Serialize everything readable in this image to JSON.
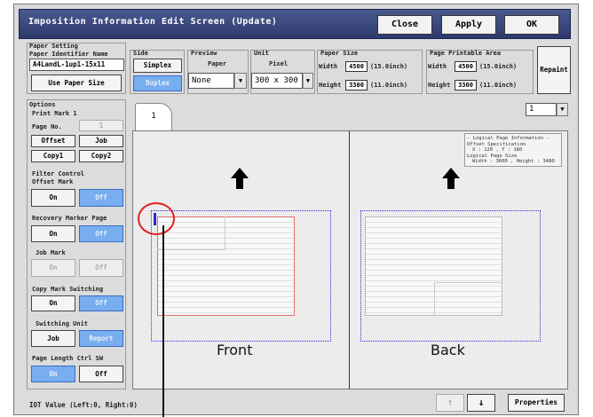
{
  "window": {
    "title": "Imposition Information Edit Screen (Update)"
  },
  "titlebar_buttons": {
    "close": "Close",
    "apply": "Apply",
    "ok": "OK"
  },
  "paper_setting": {
    "section_label": "Paper Setting",
    "identifier_label": "Paper Identifier Name",
    "identifier_value": "A4LandL-1up1-15x11",
    "use_paper_size": "Use Paper Size"
  },
  "side": {
    "label": "Side",
    "simplex": "Simplex",
    "duplex": "Duplex"
  },
  "preview": {
    "label": "Preview",
    "sub_label": "Paper",
    "value": "None"
  },
  "unit": {
    "label": "Unit",
    "sub_label": "Pixel",
    "value": "300 x 300"
  },
  "paper_size": {
    "label": "Paper Size",
    "width_label": "Width",
    "width_value": "4500",
    "width_inch": "(15.0inch)",
    "height_label": "Height",
    "height_value": "3300",
    "height_inch": "(11.0inch)"
  },
  "printable_area": {
    "label": "Page Printable Area",
    "width_label": "Width",
    "width_value": "4500",
    "width_inch": "(15.0inch)",
    "height_label": "Height",
    "height_value": "3300",
    "height_inch": "(11.0inch)"
  },
  "repaint": "Repaint",
  "options": {
    "label": "Options",
    "print_mark": {
      "label": "Print Mark 1",
      "page_no_label": "Page No.",
      "page_no_value": "1",
      "offset": "Offset",
      "job": "Job",
      "copy1": "Copy1",
      "copy2": "Copy2"
    },
    "filter_control": {
      "label": "Filter Control",
      "sub_label": "Offset Mark",
      "on": "On",
      "off": "Off"
    },
    "recovery_marker": {
      "label": "Recovery Marker Page",
      "on": "On",
      "off": "Off"
    },
    "job_mark": {
      "label": "Job Mark",
      "on": "On",
      "off": "Off"
    },
    "copy_mark": {
      "label": "Copy Mark Switching",
      "on": "On",
      "off": "Off"
    },
    "switching_unit": {
      "label": "Switching Unit",
      "job": "Job",
      "report": "Report"
    },
    "page_length": {
      "label": "Page Length Ctrl SW",
      "on": "On",
      "off": "Off"
    }
  },
  "tab": {
    "label": "1"
  },
  "page_select": {
    "value": "1"
  },
  "info_box": {
    "line1": "- Logical Page Information -",
    "line2": "Offset Specification",
    "line3": "X : 120 , Y : 180",
    "line4": "Logical Page Size",
    "line5": "Width : 3600 , Height : 3480"
  },
  "front_label": "Front",
  "back_label": "Back",
  "status": {
    "iot_value": "IOT Value (Left:0, Right:0)"
  },
  "bottom": {
    "up_arrow": "↑",
    "down_arrow": "↓",
    "properties": "Properties"
  },
  "colors": {
    "selected": "#78aef0",
    "title_bar": "#2e3a6e",
    "highlight_circle": "#e02020"
  }
}
